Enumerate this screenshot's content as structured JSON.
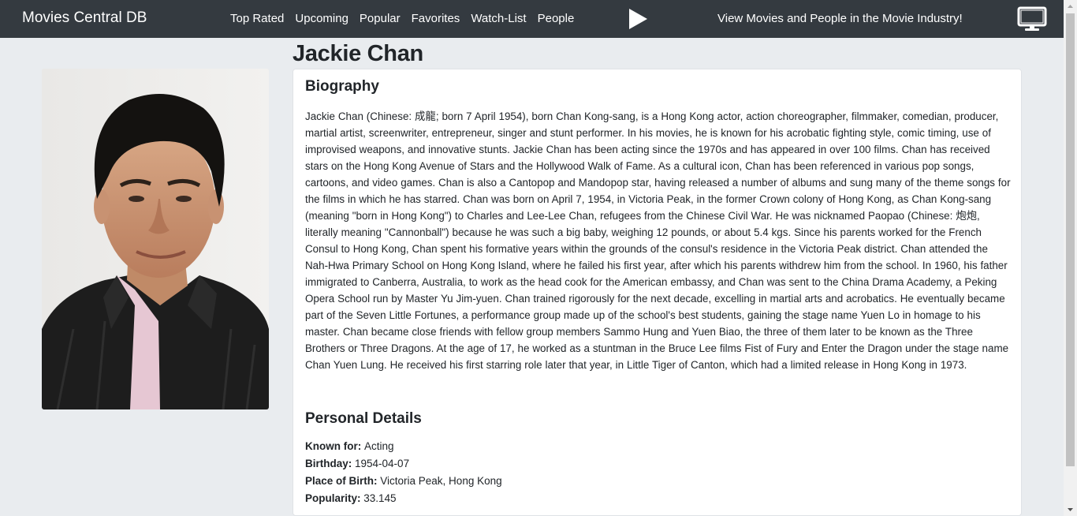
{
  "navbar": {
    "brand": "Movies Central DB",
    "links": [
      "Top Rated",
      "Upcoming",
      "Popular",
      "Favorites",
      "Watch-List",
      "People"
    ],
    "tagline": "View Movies and People in the Movie Industry!",
    "play_icon": "play-icon",
    "tv_icon": "tv-icon"
  },
  "person": {
    "name": "Jackie Chan",
    "biography_title": "Biography",
    "biography": "Jackie Chan (Chinese: 成龍; born 7 April 1954), born Chan Kong-sang, is a Hong Kong actor, action choreographer, filmmaker, comedian, producer, martial artist, screenwriter, entrepreneur, singer and stunt performer. In his movies, he is known for his acrobatic fighting style, comic timing, use of improvised weapons, and innovative stunts. Jackie Chan has been acting since the 1970s and has appeared in over 100 films. Chan has received stars on the Hong Kong Avenue of Stars and the Hollywood Walk of Fame. As a cultural icon, Chan has been referenced in various pop songs, cartoons, and video games. Chan is also a Cantopop and Mandopop star, having released a number of albums and sung many of the theme songs for the films in which he has starred. Chan was born on April 7, 1954, in Victoria Peak, in the former Crown colony of Hong Kong, as Chan Kong-sang (meaning \"born in Hong Kong\") to Charles and Lee-Lee Chan, refugees from the Chinese Civil War. He was nicknamed Paopao (Chinese: 炮炮, literally meaning \"Cannonball\") because he was such a big baby, weighing 12 pounds, or about 5.4 kgs. Since his parents worked for the French Consul to Hong Kong, Chan spent his formative years within the grounds of the consul's residence in the Victoria Peak district. Chan attended the Nah-Hwa Primary School on Hong Kong Island, where he failed his first year, after which his parents withdrew him from the school. In 1960, his father immigrated to Canberra, Australia, to work as the head cook for the American embassy, and Chan was sent to the China Drama Academy, a Peking Opera School run by Master Yu Jim-yuen. Chan trained rigorously for the next decade, excelling in martial arts and acrobatics. He eventually became part of the Seven Little Fortunes, a performance group made up of the school's best students, gaining the stage name Yuen Lo in homage to his master. Chan became close friends with fellow group members Sammo Hung and Yuen Biao, the three of them later to be known as the Three Brothers or Three Dragons. At the age of 17, he worked as a stuntman in the Bruce Lee films Fist of Fury and Enter the Dragon under the stage name Chan Yuen Lung.   He received his first starring role later that year, in Little Tiger of Canton, which had a limited release in Hong Kong in 1973.",
    "details_title": "Personal Details",
    "known_for_label": "Known for:",
    "known_for": "Acting",
    "birthday_label": "Birthday:",
    "birthday": "1954-04-07",
    "birthplace_label": "Place of Birth:",
    "birthplace": "Victoria Peak, Hong Kong",
    "popularity_label": "Popularity:",
    "popularity": "33.145"
  },
  "colors": {
    "navbar": "#343a40",
    "page_bg": "#e9ecef",
    "card_bg": "#ffffff"
  }
}
